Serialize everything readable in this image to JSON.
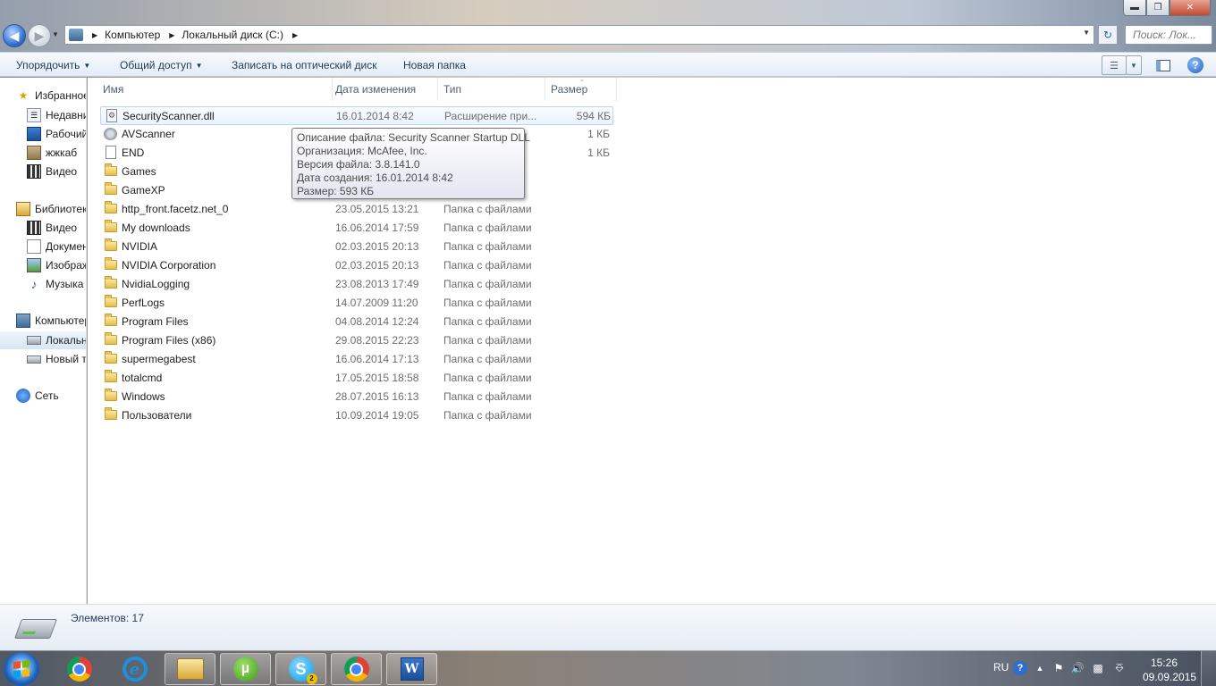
{
  "window": {
    "buttons": {
      "minimize": "▬",
      "maximize": "❐",
      "close": "✕"
    }
  },
  "address": {
    "crumbs": [
      "Компьютер",
      "Локальный диск (C:)"
    ],
    "search_placeholder": "Поиск: Лок..."
  },
  "toolbar": {
    "organize": "Упорядочить",
    "share": "Общий доступ",
    "burn": "Записать на оптический диск",
    "new_folder": "Новая папка"
  },
  "sidebar": {
    "items": [
      {
        "label": "Избранное",
        "icon": "star-icon"
      },
      {
        "label": "Недавние места",
        "icon": "recent-places-icon"
      },
      {
        "label": "Рабочий стол",
        "icon": "desktop-icon"
      },
      {
        "label": "жжкаб",
        "icon": "folder-icon"
      },
      {
        "label": "Видео",
        "icon": "video-icon"
      },
      {
        "label": "Библиотеки",
        "icon": "libraries-icon"
      },
      {
        "label": "Видео",
        "icon": "video-icon"
      },
      {
        "label": "Документы",
        "icon": "documents-icon"
      },
      {
        "label": "Изображения",
        "icon": "pictures-icon"
      },
      {
        "label": "Музыка",
        "icon": "music-icon"
      },
      {
        "label": "Компьютер",
        "icon": "computer-icon"
      },
      {
        "label": "Локальный диск (C:)",
        "icon": "local-disk-icon"
      },
      {
        "label": "Новый том",
        "icon": "drive-icon"
      },
      {
        "label": "Сеть",
        "icon": "network-icon"
      }
    ]
  },
  "columns": {
    "name": "Имя",
    "date": "Дата изменения",
    "type": "Тип",
    "size": "Размер"
  },
  "files": [
    {
      "name": "SecurityScanner.dll",
      "date": "16.01.2014 8:42",
      "type": "Расширение при...",
      "size": "594 КБ",
      "kind": "dll"
    },
    {
      "name": "AVScanner",
      "date": "",
      "type": "",
      "size": "1 КБ",
      "kind": "exe"
    },
    {
      "name": "END",
      "date": "",
      "type": "",
      "size": "1 КБ",
      "kind": "file"
    },
    {
      "name": "Games",
      "date": "",
      "type": "",
      "size": "",
      "kind": "folder"
    },
    {
      "name": "GameXP",
      "date": "",
      "type": "",
      "size": "",
      "kind": "folder"
    },
    {
      "name": "http_front.facetz.net_0",
      "date": "23.05.2015 13:21",
      "type": "Папка с файлами",
      "size": "",
      "kind": "folder"
    },
    {
      "name": "My downloads",
      "date": "16.06.2014 17:59",
      "type": "Папка с файлами",
      "size": "",
      "kind": "folder"
    },
    {
      "name": "NVIDIA",
      "date": "02.03.2015 20:13",
      "type": "Папка с файлами",
      "size": "",
      "kind": "folder"
    },
    {
      "name": "NVIDIA Corporation",
      "date": "02.03.2015 20:13",
      "type": "Папка с файлами",
      "size": "",
      "kind": "folder"
    },
    {
      "name": "NvidiaLogging",
      "date": "23.08.2013 17:49",
      "type": "Папка с файлами",
      "size": "",
      "kind": "folder"
    },
    {
      "name": "PerfLogs",
      "date": "14.07.2009 11:20",
      "type": "Папка с файлами",
      "size": "",
      "kind": "folder"
    },
    {
      "name": "Program Files",
      "date": "04.08.2014 12:24",
      "type": "Папка с файлами",
      "size": "",
      "kind": "folder"
    },
    {
      "name": "Program Files (x86)",
      "date": "29.08.2015 22:23",
      "type": "Папка с файлами",
      "size": "",
      "kind": "folder"
    },
    {
      "name": "supermegabest",
      "date": "16.06.2014 17:13",
      "type": "Папка с файлами",
      "size": "",
      "kind": "folder"
    },
    {
      "name": "totalcmd",
      "date": "17.05.2015 18:58",
      "type": "Папка с файлами",
      "size": "",
      "kind": "folder"
    },
    {
      "name": "Windows",
      "date": "28.07.2015 16:13",
      "type": "Папка с файлами",
      "size": "",
      "kind": "folder"
    },
    {
      "name": "Пользователи",
      "date": "10.09.2014 19:05",
      "type": "Папка с файлами",
      "size": "",
      "kind": "folder"
    }
  ],
  "tooltip": {
    "line1": "Описание файла: Security Scanner Startup DLL",
    "line2": "Организация: McAfee, Inc.",
    "line3": "Версия файла: 3.8.141.0",
    "line4": "Дата создания: 16.01.2014 8:42",
    "line5": "Размер: 593 КБ"
  },
  "status": {
    "item_count": "Элементов: 17"
  },
  "taskbar": {
    "lang": "RU",
    "time": "15:26",
    "date": "09.09.2015",
    "skype_badge": "2"
  }
}
